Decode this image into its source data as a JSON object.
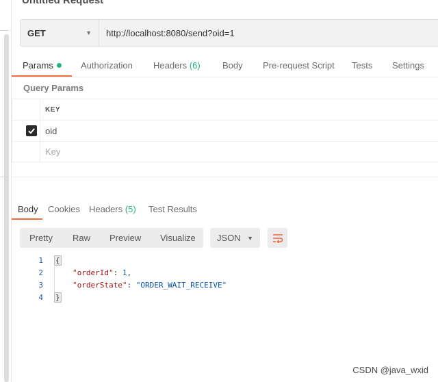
{
  "request": {
    "title": "Untitled Request",
    "method": "GET",
    "url": "http://localhost:8080/send?oid=1"
  },
  "request_tabs": [
    {
      "label": "Params",
      "active": true
    },
    {
      "label": "Authorization"
    },
    {
      "label": "Headers",
      "count": "(6)"
    },
    {
      "label": "Body"
    },
    {
      "label": "Pre-request Script"
    },
    {
      "label": "Tests"
    },
    {
      "label": "Settings"
    }
  ],
  "query_params": {
    "label": "Query Params",
    "header_key": "KEY",
    "rows": [
      {
        "key": "oid",
        "checked": true
      }
    ],
    "key_placeholder": "Key"
  },
  "response_tabs": [
    {
      "label": "Body",
      "active": true
    },
    {
      "label": "Cookies"
    },
    {
      "label": "Headers",
      "count": "(5)"
    },
    {
      "label": "Test Results"
    }
  ],
  "view_modes": [
    "Pretty",
    "Raw",
    "Preview",
    "Visualize"
  ],
  "format": "JSON",
  "icons": {
    "dropdown": "chevron-down-icon",
    "wrap": "wrap-lines-icon",
    "check": "check-icon"
  },
  "colors": {
    "accent": "#f26b3a",
    "green": "#26b47f"
  },
  "response_body": {
    "line_numbers": [
      "1",
      "2",
      "3",
      "4"
    ],
    "open_brace": "{",
    "close_brace": "}",
    "fields": [
      {
        "key": "\"orderId\"",
        "sep": ": ",
        "value": "1",
        "trail": ","
      },
      {
        "key": "\"orderState\"",
        "sep": ": ",
        "value": "\"ORDER_WAIT_RECEIVE\"",
        "trail": ""
      }
    ]
  },
  "watermark": "CSDN @java_wxid"
}
